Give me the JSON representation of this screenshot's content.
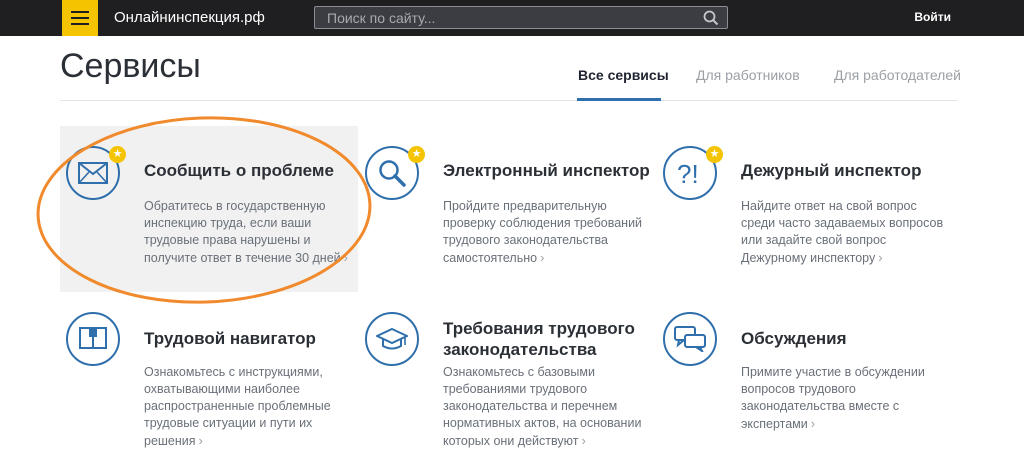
{
  "header": {
    "site_name": "Онлайнинспекция.рф",
    "search_placeholder": "Поиск по сайту...",
    "login_label": "Войти",
    "menu_icon": "hamburger-icon",
    "search_icon": "search-icon",
    "brand_color": "#f5c400",
    "bar_color": "#1f1f21"
  },
  "page": {
    "title": "Сервисы",
    "tabs": [
      {
        "label": "Все сервисы",
        "active": true
      },
      {
        "label": "Для работников",
        "active": false
      },
      {
        "label": "Для работодателей",
        "active": false
      }
    ],
    "accent_color": "#2f6fab"
  },
  "services": [
    {
      "title": "Сообщить о проблеме",
      "desc_lines": [
        "Обратитесь в государственную",
        "инспекцию труда, если ваши",
        "трудовые права нарушены и",
        "получите ответ в течение 30 дней"
      ],
      "icon": "envelope-icon",
      "starred": true,
      "highlighted": true
    },
    {
      "title": "Электронный инспектор",
      "desc_lines": [
        "Пройдите предварительную",
        "проверку соблюдения требований",
        "трудового законодательства",
        "самостоятельно"
      ],
      "icon": "magnifier-icon",
      "starred": true,
      "highlighted": false
    },
    {
      "title": "Дежурный инспектор",
      "desc_lines": [
        "Найдите ответ на свой вопрос",
        "среди часто задаваемых вопросов",
        "или задайте свой вопрос",
        "Дежурному инспектору"
      ],
      "icon": "question-exclamation-icon",
      "starred": true,
      "highlighted": false
    },
    {
      "title": "Трудовой навигатор",
      "desc_lines": [
        "Ознакомьтесь с инструкциями,",
        "охватывающими наиболее",
        "распространенные проблемные",
        "трудовые ситуации и пути их",
        "решения"
      ],
      "icon": "book-icon",
      "starred": false,
      "highlighted": false
    },
    {
      "title_lines": [
        "Требования трудового",
        "законодательства"
      ],
      "desc_lines": [
        "Ознакомьтесь с базовыми",
        "требованиями трудового",
        "законодательства и перечнем",
        "нормативных актов, на основании",
        "которых они действуют"
      ],
      "icon": "graduation-cap-icon",
      "starred": false,
      "highlighted": false
    },
    {
      "title": "Обсуждения",
      "desc_lines": [
        "Примите участие в обсуждении",
        "вопросов трудового",
        "законодательства вместе с",
        "экспертами"
      ],
      "icon": "chat-bubbles-icon",
      "starred": false,
      "highlighted": false
    }
  ],
  "annotation": {
    "shape": "orange-oval",
    "color": "#f08a2c"
  }
}
